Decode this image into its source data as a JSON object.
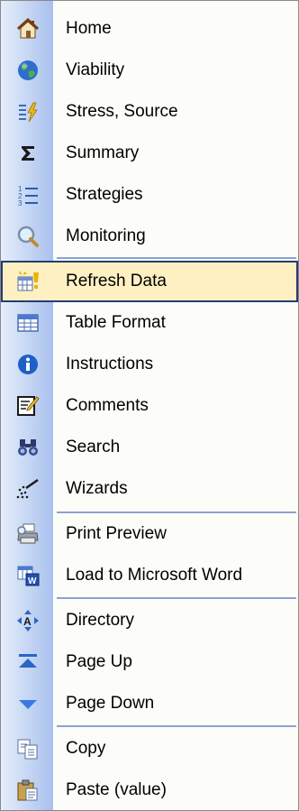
{
  "menu": {
    "items": [
      {
        "label": "Home",
        "icon": "home-icon"
      },
      {
        "label": "Viability",
        "icon": "globe-icon"
      },
      {
        "label": "Stress, Source",
        "icon": "lightning-list-icon"
      },
      {
        "label": "Summary",
        "icon": "sigma-icon"
      },
      {
        "label": "Strategies",
        "icon": "numbered-list-icon"
      },
      {
        "label": "Monitoring",
        "icon": "magnifier-icon"
      },
      {
        "label": "Refresh Data",
        "icon": "refresh-data-icon",
        "selected": true
      },
      {
        "label": "Table Format",
        "icon": "table-icon"
      },
      {
        "label": "Instructions",
        "icon": "info-icon"
      },
      {
        "label": "Comments",
        "icon": "note-pencil-icon"
      },
      {
        "label": "Search",
        "icon": "binoculars-icon"
      },
      {
        "label": "Wizards",
        "icon": "magic-wand-icon"
      },
      {
        "label": "Print Preview",
        "icon": "print-preview-icon"
      },
      {
        "label": "Load to Microsoft Word",
        "icon": "word-document-icon"
      },
      {
        "label": "Directory",
        "icon": "directory-arrows-icon"
      },
      {
        "label": "Page Up",
        "icon": "page-up-icon"
      },
      {
        "label": "Page Down",
        "icon": "page-down-icon"
      },
      {
        "label": "Copy",
        "icon": "copy-icon"
      },
      {
        "label": "Paste (value)",
        "icon": "paste-icon"
      }
    ]
  },
  "colors": {
    "highlight_fill": "#fff0c2",
    "highlight_border": "#243b73",
    "icon_strip": "#c4d5f3",
    "separator": "#8aa3cf"
  }
}
